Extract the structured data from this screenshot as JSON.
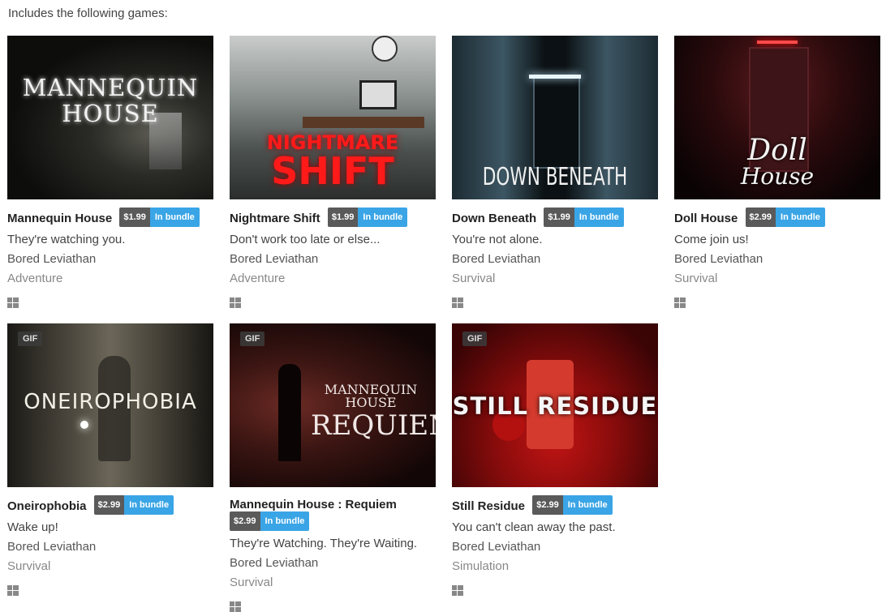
{
  "intro": "Includes the following games:",
  "gif_label": "GIF",
  "games": [
    {
      "title": "Mannequin House",
      "price": "$1.99",
      "bundle": "In bundle",
      "desc": "They're watching you.",
      "dev": "Bored Leviathan",
      "genre": "Adventure",
      "thumb_text": "MANNEQUIN HOUSE",
      "platform_icon": "windows-icon"
    },
    {
      "title": "Nightmare Shift",
      "price": "$1.99",
      "bundle": "In bundle",
      "desc": "Don't work too late or else...",
      "dev": "Bored Leviathan",
      "genre": "Adventure",
      "thumb_text": "NIGHTMARE SHIFT",
      "platform_icon": "windows-icon"
    },
    {
      "title": "Down Beneath",
      "price": "$1.99",
      "bundle": "In bundle",
      "desc": "You're not alone.",
      "dev": "Bored Leviathan",
      "genre": "Survival",
      "thumb_text": "DOWN BENEATH",
      "platform_icon": "windows-icon"
    },
    {
      "title": "Doll House",
      "price": "$2.99",
      "bundle": "In bundle",
      "desc": "Come join us!",
      "dev": "Bored Leviathan",
      "genre": "Survival",
      "thumb_text": "Doll House",
      "platform_icon": "windows-icon"
    },
    {
      "title": "Oneirophobia",
      "price": "$2.99",
      "bundle": "In bundle",
      "desc": "Wake up!",
      "dev": "Bored Leviathan",
      "genre": "Survival",
      "thumb_text": "ONEIROPHOBIA",
      "platform_icon": "windows-icon"
    },
    {
      "title": "Mannequin House : Requiem",
      "price": "$2.99",
      "bundle": "In bundle",
      "desc": "They're Watching. They're Waiting.",
      "dev": "Bored Leviathan",
      "genre": "Survival",
      "thumb_text": "MANNEQUIN HOUSE REQUIEM",
      "platform_icon": "windows-icon"
    },
    {
      "title": "Still Residue",
      "price": "$2.99",
      "bundle": "In bundle",
      "desc": "You can't clean away the past.",
      "dev": "Bored Leviathan",
      "genre": "Simulation",
      "thumb_text": "STILL RESIDUE",
      "platform_icon": "windows-icon"
    }
  ]
}
